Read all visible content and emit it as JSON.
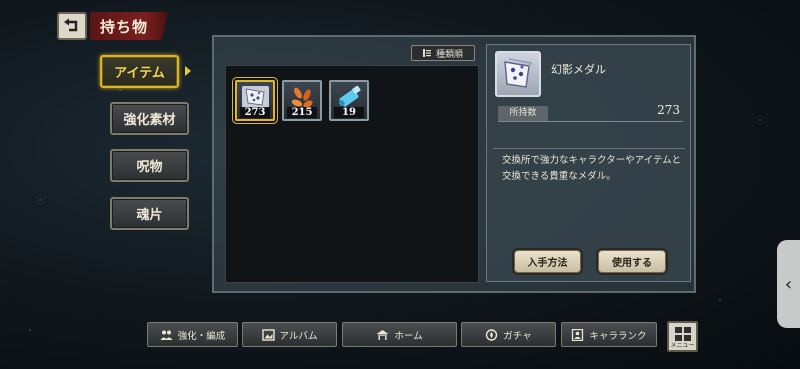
{
  "header": {
    "title": "持ち物"
  },
  "categories": [
    {
      "label": "アイテム",
      "active": true
    },
    {
      "label": "強化素材",
      "active": false
    },
    {
      "label": "呪物",
      "active": false
    },
    {
      "label": "魂片",
      "active": false
    }
  ],
  "sort": {
    "label": "種類順",
    "icon": "sort-icon"
  },
  "inventory": {
    "items": [
      {
        "name": "幻影メダル",
        "count": "273",
        "icon": "medal-icon",
        "selected": true
      },
      {
        "name": "",
        "count": "215",
        "icon": "petals-icon",
        "selected": false
      },
      {
        "name": "",
        "count": "19",
        "icon": "scroll-icon",
        "selected": false
      }
    ]
  },
  "detail": {
    "name": "幻影メダル",
    "owned_label": "所持数",
    "owned_value": "273",
    "description": "交換所で強力なキャラクターやアイテムと交換できる貴重なメダル。",
    "buttons": {
      "obtain": "入手方法",
      "use": "使用する"
    }
  },
  "bottom_nav": [
    {
      "label": "強化・編成",
      "icon": "party-icon"
    },
    {
      "label": "アルバム",
      "icon": "album-icon"
    },
    {
      "label": "ホーム",
      "icon": "home-icon"
    },
    {
      "label": "ガチャ",
      "icon": "gacha-icon"
    },
    {
      "label": "キャラランク",
      "icon": "rank-icon"
    }
  ],
  "menu": {
    "label": "メニュー",
    "icon": "grid-icon"
  },
  "colors": {
    "accent_gold": "#e0b62a",
    "banner_red": "#6b1a1a",
    "button_cream": "#e6dcc4"
  }
}
